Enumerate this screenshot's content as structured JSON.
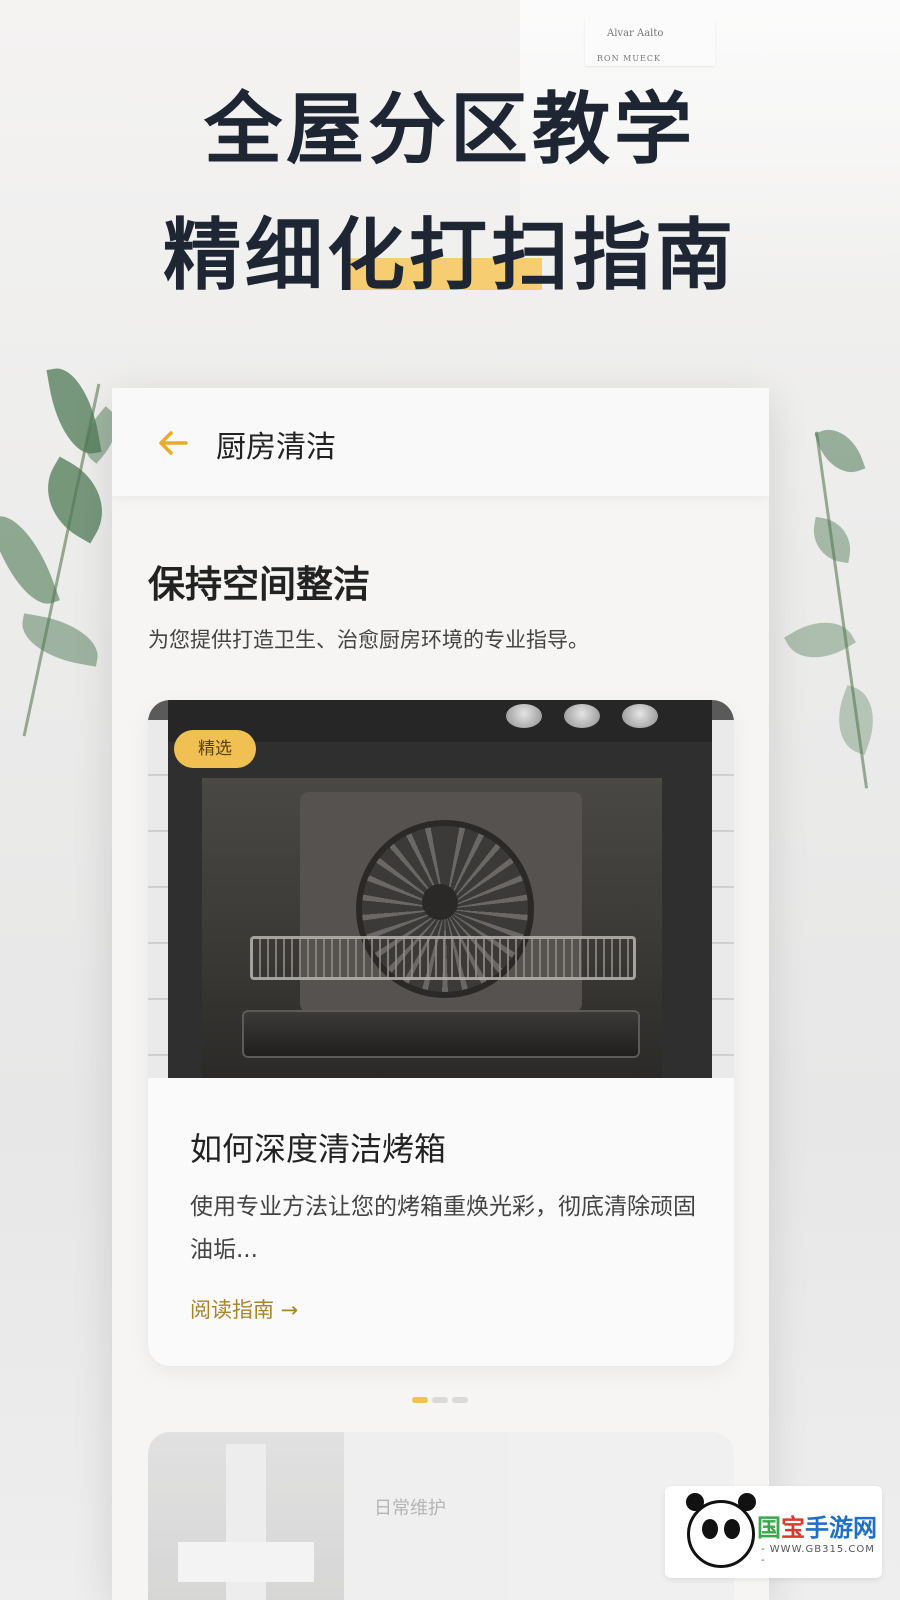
{
  "background": {
    "book_spine_text_1": "Alvar Aalto",
    "book_spine_text_2": "RON MUECK"
  },
  "hero": {
    "line1": "全屋分区教学",
    "line2": "精细化打扫指南",
    "highlight_color": "#f7c75a"
  },
  "appbar": {
    "back_icon": "arrow-left-icon",
    "title": "厨房清洁"
  },
  "section": {
    "title": "保持空间整洁",
    "subtitle": "为您提供打造卫生、治愈厨房环境的专业指导。"
  },
  "featured_card": {
    "badge": "精选",
    "title": "如何深度清洁烤箱",
    "description": "使用专业方法让您的烤箱重焕光彩，彻底清除顽固油垢...",
    "link": "阅读指南 →"
  },
  "pagination": {
    "count": 3,
    "active_index": 0
  },
  "second_card": {
    "tag": "日常维护"
  },
  "watermark": {
    "brand_1": "国",
    "brand_2": "宝",
    "brand_3": "手游网",
    "url": "- WWW.GB315.COM -"
  },
  "colors": {
    "accent": "#f0c152",
    "back_arrow": "#e8ab2a",
    "link": "#a8842c",
    "hero_text": "#1f2633"
  }
}
